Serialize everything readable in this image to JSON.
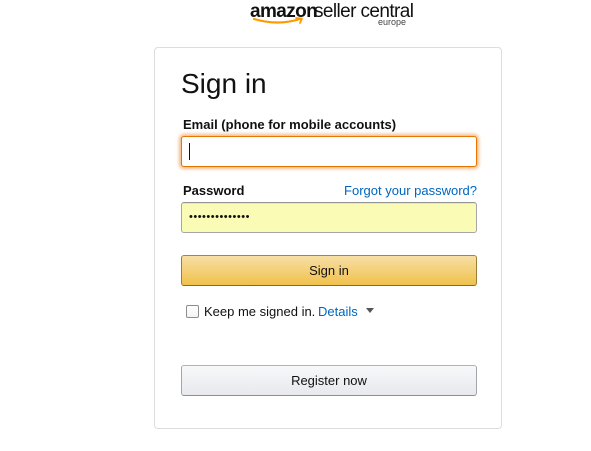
{
  "logo": {
    "brand": "amazon",
    "product": "seller central",
    "region": "europe",
    "smile_color": "#f90"
  },
  "form": {
    "title": "Sign in",
    "email": {
      "label": "Email (phone for mobile accounts)",
      "value": ""
    },
    "password": {
      "label": "Password",
      "masked_value": "••••••••••••••",
      "forgot_link": "Forgot your password?"
    },
    "signin_button": "Sign in",
    "keep_signed_in": {
      "label": "Keep me signed in.",
      "details_link": "Details",
      "checked": false
    },
    "register_button": "Register now"
  },
  "colors": {
    "link": "#0066c0",
    "primary_button_top": "#f7dfa5",
    "primary_button_bottom": "#f0c14b",
    "focus_border": "#e77600",
    "autofill_background": "#fafcb6"
  }
}
